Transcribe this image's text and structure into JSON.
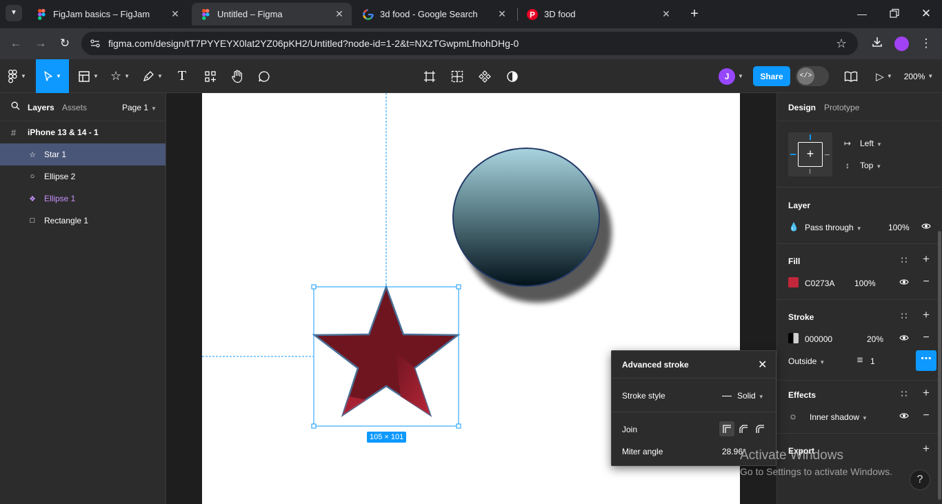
{
  "browser": {
    "tabs": [
      {
        "title": "FigJam basics – FigJam",
        "favicon": "figma-icon"
      },
      {
        "title": "Untitled – Figma",
        "favicon": "figma-icon",
        "active": true
      },
      {
        "title": "3d food - Google Search",
        "favicon": "google-icon"
      },
      {
        "title": "3D food",
        "favicon": "pinterest-icon"
      }
    ],
    "url": "figma.com/design/tT7PYYEYX0lat2YZ06pKH2/Untitled?node-id=1-2&t=NXzTGwpmLfnohDHg-0"
  },
  "toolbar": {
    "avatar_letter": "J",
    "share_label": "Share",
    "zoom": "200%"
  },
  "left_panel": {
    "tabs": [
      "Layers",
      "Assets"
    ],
    "page": "Page 1",
    "frame": "iPhone 13 & 14 - 1",
    "layers": [
      {
        "label": "Star 1",
        "icon": "star-icon",
        "selected": true
      },
      {
        "label": "Ellipse 2",
        "icon": "ellipse-icon"
      },
      {
        "label": "Ellipse 1",
        "icon": "component-icon",
        "component": true
      },
      {
        "label": "Rectangle 1",
        "icon": "rectangle-icon"
      }
    ]
  },
  "canvas": {
    "selection_size": "105 × 101",
    "star_fill": "#6e1520",
    "star_highlight": "#c0273a",
    "star_stroke": "#4a6f96"
  },
  "right_panel": {
    "tabs": [
      "Design",
      "Prototype"
    ],
    "constraints": {
      "horizontal": "Left",
      "vertical": "Top"
    },
    "layer": {
      "title": "Layer",
      "blend": "Pass through",
      "opacity": "100%"
    },
    "fill": {
      "title": "Fill",
      "color_hex": "C0273A",
      "swatch": "#c0273a",
      "opacity": "100%"
    },
    "stroke": {
      "title": "Stroke",
      "color_hex": "000000",
      "opacity": "20%",
      "position": "Outside",
      "weight": "1"
    },
    "effects": {
      "title": "Effects",
      "effect": "Inner shadow"
    },
    "export": {
      "title": "Export"
    }
  },
  "advanced_stroke": {
    "title": "Advanced stroke",
    "style_label": "Stroke style",
    "style_value": "Solid",
    "join_label": "Join",
    "miter_label": "Miter angle",
    "miter_value": "28.96°"
  },
  "watermark": {
    "line1": "Activate Windows",
    "line2": "Go to Settings to activate Windows."
  },
  "help": "?"
}
